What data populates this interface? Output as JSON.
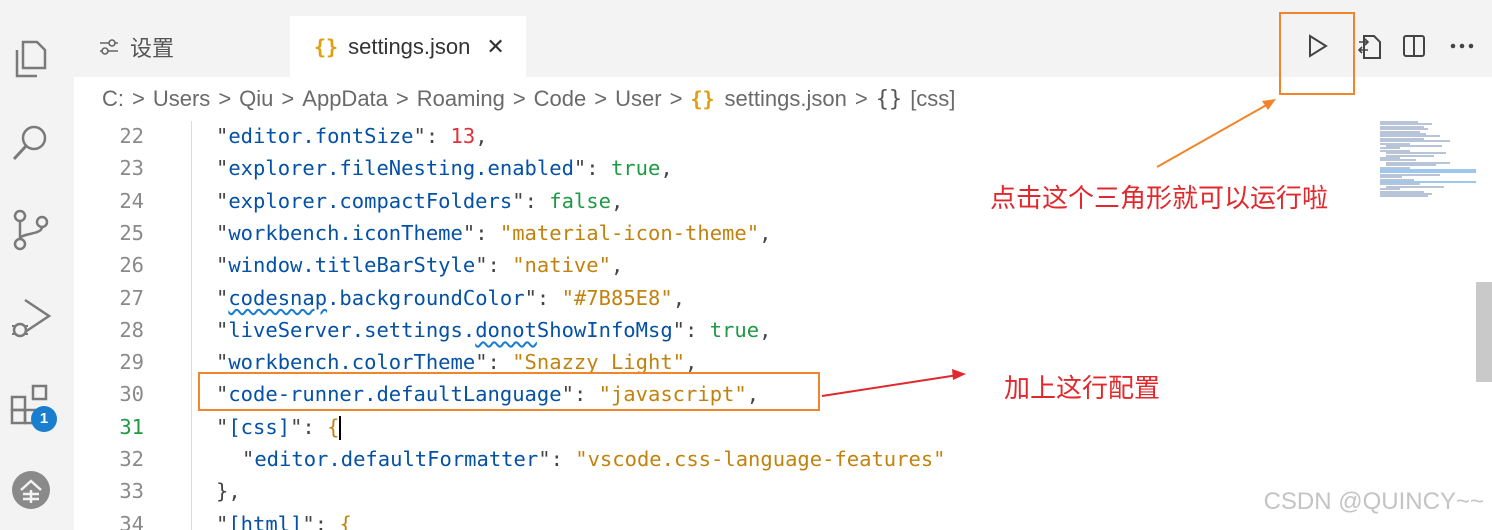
{
  "tabs": [
    {
      "label": "设置",
      "active": false
    },
    {
      "label": "settings.json",
      "active": true,
      "close": "✕"
    }
  ],
  "breadcrumb": {
    "items": [
      "C:",
      "Users",
      "Qiu",
      "AppData",
      "Roaming",
      "Code",
      "User",
      "settings.json",
      "[css]"
    ],
    "separator": ">"
  },
  "badge": {
    "count": "1"
  },
  "editor": {
    "lines": [
      {
        "num": "22",
        "key": "editor.fontSize",
        "value": "13",
        "type": "number",
        "trail": ","
      },
      {
        "num": "23",
        "key": "explorer.fileNesting.enabled",
        "value": "true",
        "type": "bool",
        "trail": ","
      },
      {
        "num": "24",
        "key": "explorer.compactFolders",
        "value": "false",
        "type": "bool",
        "trail": ","
      },
      {
        "num": "25",
        "key": "workbench.iconTheme",
        "value": "\"material-icon-theme\"",
        "type": "string",
        "trail": ","
      },
      {
        "num": "26",
        "key": "window.titleBarStyle",
        "value": "\"native\"",
        "type": "string",
        "trail": ","
      },
      {
        "num": "27",
        "key": "codesnap.backgroundColor",
        "value": "\"#7B85E8\"",
        "type": "string",
        "trail": ","
      },
      {
        "num": "28",
        "key": "liveServer.settings.donotShowInfoMsg",
        "value": "true",
        "type": "bool",
        "trail": ","
      },
      {
        "num": "29",
        "key": "workbench.colorTheme",
        "value": "\"Snazzy Light\"",
        "type": "string",
        "trail": ","
      },
      {
        "num": "30",
        "key": "code-runner.defaultLanguage",
        "value": "\"javascript\"",
        "type": "string",
        "trail": ","
      },
      {
        "num": "31",
        "key": "[css]",
        "value": "{",
        "type": "brace",
        "trail": ""
      },
      {
        "num": "32",
        "key": "editor.defaultFormatter",
        "value": "\"vscode.css-language-features\"",
        "type": "string",
        "trail": ""
      },
      {
        "num": "33",
        "key": "",
        "value": "},",
        "type": "close",
        "trail": ""
      },
      {
        "num": "34",
        "key": "[html]",
        "value": "{",
        "type": "brace",
        "trail": ""
      }
    ],
    "active_line": "31"
  },
  "annotations": {
    "run_hint": "点击这个三角形就可以运行啦",
    "add_hint": "加上这行配置"
  },
  "watermark": "CSDN @QUINCY~~",
  "colors": {
    "highlight_box": "#f0852b",
    "annotation_text": "#e0292d",
    "key": "#0451a5",
    "string": "#c2820f",
    "number": "#e0313a",
    "boolean": "#1f9a44",
    "badge": "#1a7ecf"
  }
}
